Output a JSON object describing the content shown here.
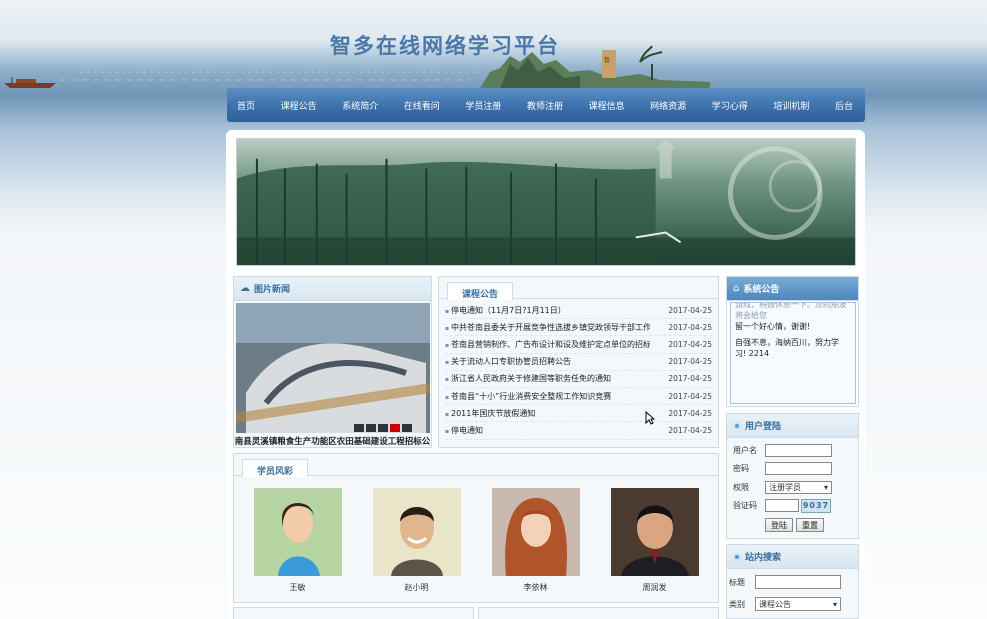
{
  "site": {
    "title": "智多在线网络学习平台"
  },
  "nav": {
    "items": [
      "首页",
      "课程公告",
      "系统简介",
      "在线看问",
      "学员注册",
      "教师注册",
      "课程信息",
      "网络资源",
      "学习心得",
      "培训机制",
      "后台"
    ]
  },
  "photo_news": {
    "title": "图片新闻",
    "caption": "南县灵溪镇粮食生产功能区农田基础建设工程招标公",
    "pager": [
      "1",
      "2",
      "3",
      "4",
      "5"
    ]
  },
  "course_news": {
    "title": "课程公告",
    "items": [
      {
        "text": "停电通知（11月7日?1月11日）",
        "date": "2017-04-25"
      },
      {
        "text": "中共苍南县委关于开展竞争性选拔乡镇党政领导干部工作",
        "date": "2017-04-25"
      },
      {
        "text": "苍南县营销制作、广告布设计和设及维护定点单位的招标",
        "date": "2017-04-25"
      },
      {
        "text": "关于流动人口专职协管员招聘公告",
        "date": "2017-04-25"
      },
      {
        "text": "浙江省人民政府关于修建国等职务任免的通知",
        "date": "2017-04-25"
      },
      {
        "text": "苍南县“十小”行业消费安全整规工作知识竞赛",
        "date": "2017-04-25"
      },
      {
        "text": "2011年国庆节放假通知",
        "date": "2017-04-25"
      },
      {
        "text": "停电通知",
        "date": "2017-04-25"
      }
    ]
  },
  "students": {
    "title": "学员风彩",
    "items": [
      {
        "name": "王敏"
      },
      {
        "name": "赵小明"
      },
      {
        "name": "李依林"
      },
      {
        "name": "周润发"
      }
    ]
  },
  "system_notice": {
    "title": "系统公告",
    "lines": [
      "游戏，稍微休息一下。您的朋友将会给您",
      "留一个好心情，谢谢!",
      "自强不息，海纳百川，努力学",
      "习! 2214"
    ]
  },
  "login": {
    "title": "用户登陆",
    "username_label": "用户名",
    "password_label": "密码",
    "role_label": "权限",
    "role_value": "注册学员",
    "captcha_label": "验证码",
    "captcha_code": "9037",
    "login_button": "登陆",
    "reset_button": "重置"
  },
  "site_search": {
    "title": "站内搜索",
    "keyword_label": "标题",
    "category_label": "类别",
    "category_value": "课程公告"
  },
  "colors": {
    "nav": "#3e73ad",
    "accent": "#3a6e9e",
    "panel_border": "#cddbe7"
  }
}
